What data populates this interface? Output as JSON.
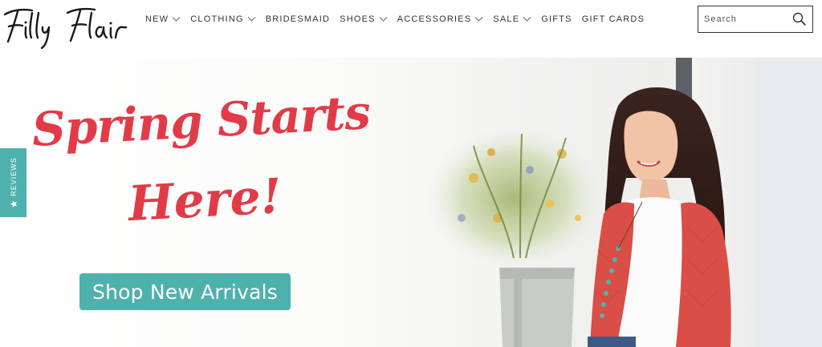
{
  "brand": {
    "name": "Filly Flair"
  },
  "nav": {
    "items": [
      {
        "label": "NEW",
        "dropdown": true
      },
      {
        "label": "CLOTHING",
        "dropdown": true
      },
      {
        "label": "BRIDESMAID",
        "dropdown": false
      },
      {
        "label": "SHOES",
        "dropdown": true
      },
      {
        "label": "ACCESSORIES",
        "dropdown": true
      },
      {
        "label": "SALE",
        "dropdown": true
      },
      {
        "label": "GIFTS",
        "dropdown": false
      },
      {
        "label": "GIFT CARDS",
        "dropdown": false
      }
    ]
  },
  "search": {
    "placeholder": "Search",
    "icon": "search-icon"
  },
  "hero": {
    "headline_line1": "Spring Starts",
    "headline_line2": "Here!",
    "cta_label": "Shop New Arrivals"
  },
  "reviews_tab": {
    "label": "REVIEWS",
    "icon": "star-icon"
  },
  "colors": {
    "headline": "#e23b48",
    "accent": "#4fb1ad",
    "cardigan": "#d94e46",
    "text": "#333333"
  }
}
